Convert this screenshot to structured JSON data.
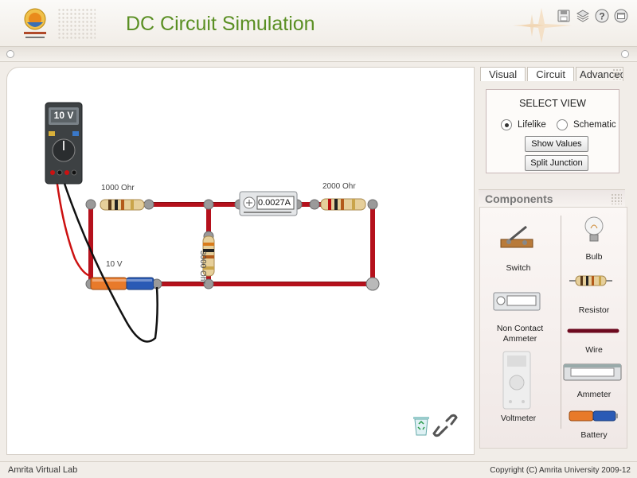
{
  "header": {
    "title": "DC Circuit Simulation"
  },
  "toolbar_icons": [
    "save-icon",
    "layers-icon",
    "help-icon",
    "window-icon"
  ],
  "canvas": {
    "multimeter_display": "10 V",
    "labels": {
      "r1": "1000 Ohr",
      "r2": "2000 Ohr",
      "r3": "3000 Ohr",
      "battery": "10 V"
    },
    "ammeter_reading": "0.0027A",
    "tools": [
      "recycle-bin-icon",
      "link-icon"
    ]
  },
  "tabs": [
    {
      "label": "Visual"
    },
    {
      "label": "Circuit"
    },
    {
      "label": "Advanced"
    }
  ],
  "view": {
    "title": "SELECT VIEW",
    "options": [
      {
        "label": "Lifelike",
        "selected": true
      },
      {
        "label": "Schematic",
        "selected": false
      }
    ],
    "buttons": {
      "show_values": "Show Values",
      "split_junction": "Split Junction"
    }
  },
  "components": {
    "title": "Components",
    "items": [
      {
        "label": "Switch"
      },
      {
        "label": "Bulb"
      },
      {
        "label": "Resistor"
      },
      {
        "label": "Non Contact\nAmmeter"
      },
      {
        "label": "Wire"
      },
      {
        "label": "Ammeter"
      },
      {
        "label": "Voltmeter"
      },
      {
        "label": "Battery"
      }
    ]
  },
  "footer": {
    "left": "Amrita Virtual Lab",
    "right": "Copyright (C) Amrita University 2009-12"
  },
  "colors": {
    "title_green": "#5a8f23",
    "wire": "#b5111c",
    "lead_red": "#cc1111"
  }
}
